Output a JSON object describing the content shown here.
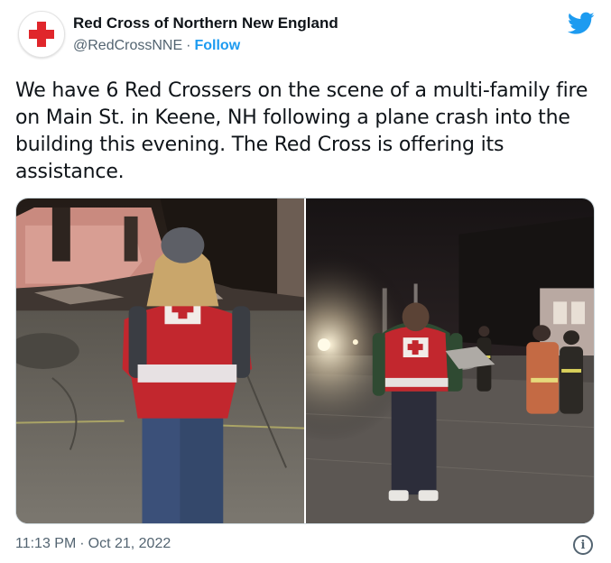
{
  "tweet": {
    "author": {
      "name": "Red Cross of Northern New England",
      "handle": "@RedCrossNNE",
      "separator": "·",
      "follow_label": "Follow",
      "avatar_icon": "red-cross-logo"
    },
    "platform_icon": "twitter-bird-icon",
    "text": "We have 6 Red Crossers on the scene of a multi-family fire on Main St. in Keene, NH following a plane crash into the building this evening. The Red Cross is offering its assistance.",
    "media": [
      {
        "icon": "photo-volunteer-at-fire-debris"
      },
      {
        "icon": "photo-responders-at-night-scene"
      }
    ],
    "time": "11:13 PM",
    "separator": "·",
    "date": "Oct 21, 2022",
    "info_glyph": "i"
  },
  "colors": {
    "accent": "#1d9bf0",
    "red_cross": "#e0262b",
    "text": "#0f1419",
    "muted": "#536471"
  }
}
